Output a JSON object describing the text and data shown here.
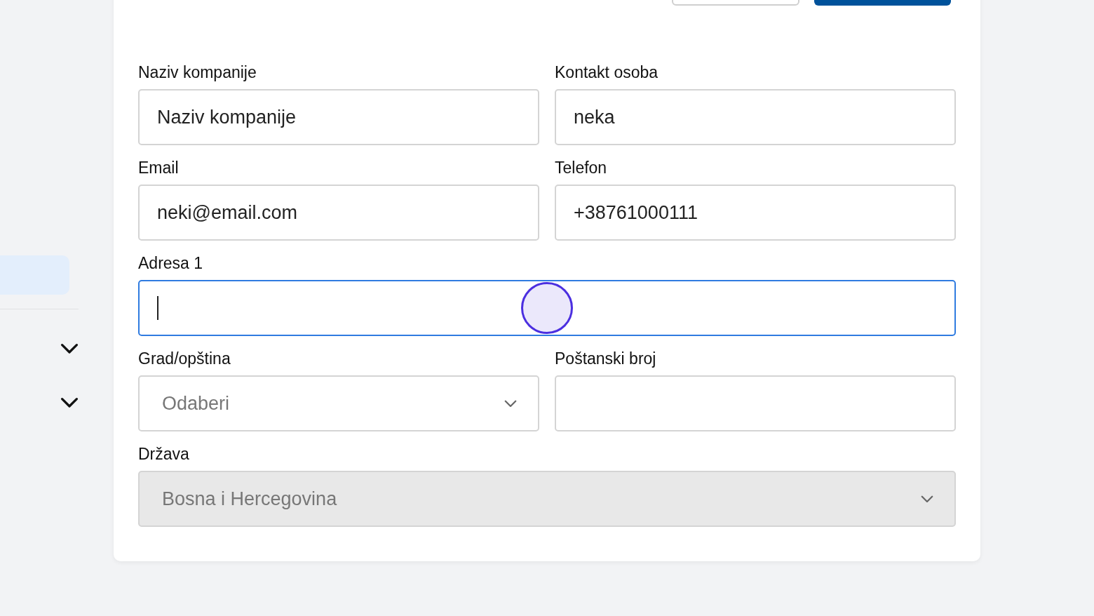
{
  "sidebar": {
    "items": [
      {
        "kind": "plain",
        "selected": true
      },
      {
        "kind": "expandable",
        "selected": false
      },
      {
        "kind": "expandable",
        "selected": false
      }
    ]
  },
  "toolbar": {
    "buttons": [
      {
        "kind": "outline"
      },
      {
        "kind": "primary"
      }
    ]
  },
  "form": {
    "fields": [
      {
        "label": "Naziv kompanije",
        "kind": "text",
        "value": "Naziv kompanije",
        "wide": false,
        "focused": false,
        "disabled": false
      },
      {
        "label": "Kontakt osoba",
        "kind": "text",
        "value": "neka",
        "wide": false,
        "focused": false,
        "disabled": false
      },
      {
        "label": "Email",
        "kind": "text",
        "value": "neki@email.com",
        "wide": false,
        "focused": false,
        "disabled": false
      },
      {
        "label": "Telefon",
        "kind": "text",
        "value": "+38761000111",
        "wide": false,
        "focused": false,
        "disabled": false
      },
      {
        "label": "Adresa 1",
        "kind": "text",
        "wide": true,
        "focused": true,
        "disabled": false
      },
      {
        "label": "Grad/opština",
        "kind": "select",
        "placeholder": "Odaberi",
        "wide": false,
        "focused": false,
        "disabled": false
      },
      {
        "label": "Poštanski broj",
        "kind": "text",
        "wide": false,
        "focused": false,
        "disabled": false
      },
      {
        "label": "Država",
        "kind": "select",
        "value": "Bosna i Hercegovina",
        "wide": true,
        "focused": false,
        "disabled": true
      }
    ]
  }
}
